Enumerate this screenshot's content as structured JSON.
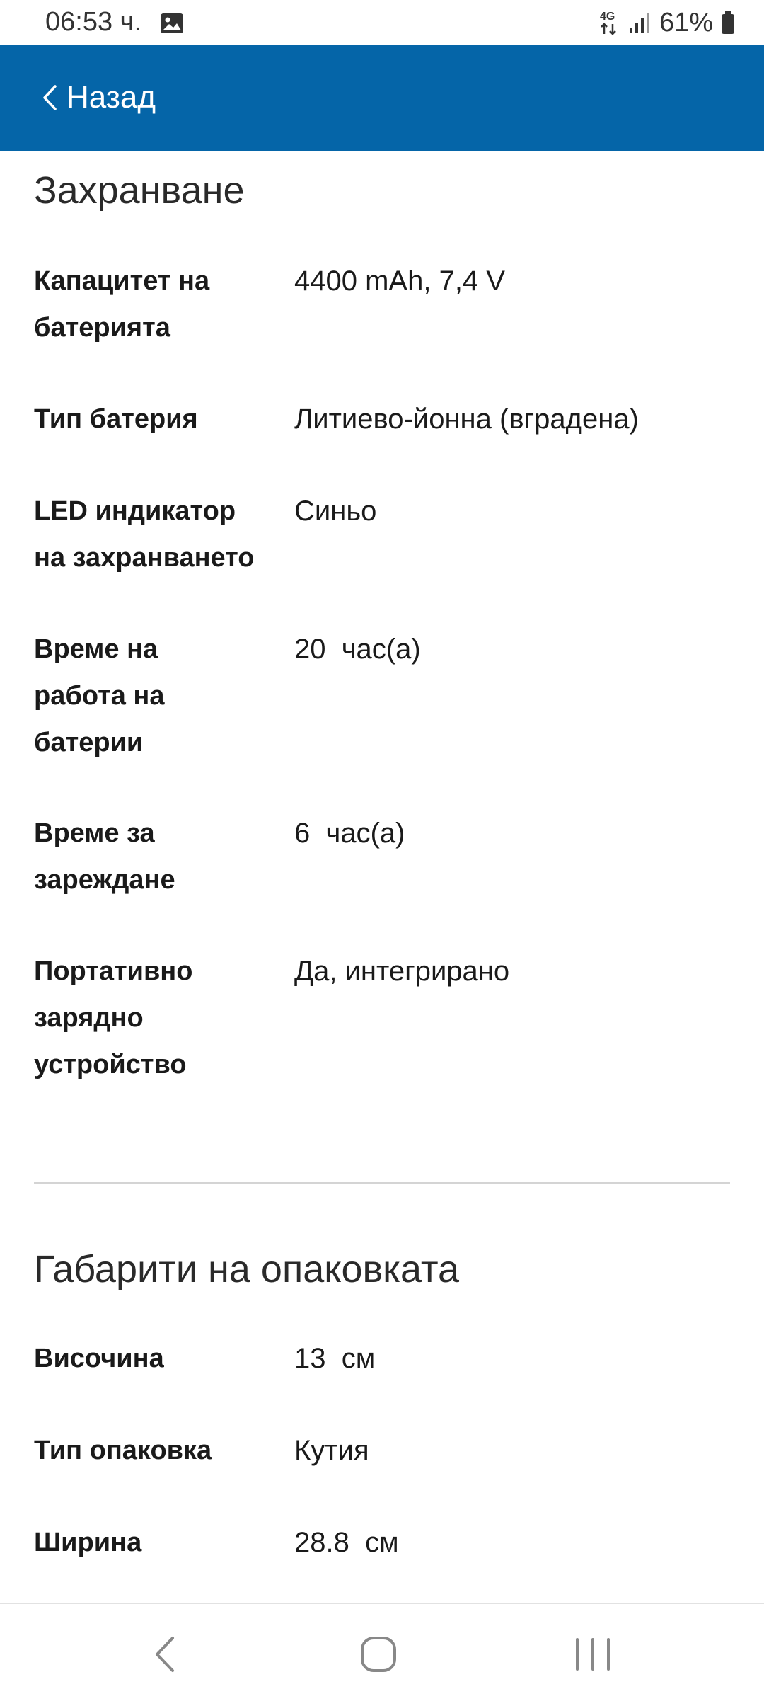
{
  "status_bar": {
    "time": "06:53 ч.",
    "battery": "61%",
    "network": "4G",
    "icons": [
      "image-icon",
      "network-4g-icon",
      "signal-icon",
      "battery-icon"
    ]
  },
  "header": {
    "back_label": "Назад",
    "background_color": "#0565a8"
  },
  "sections": [
    {
      "title": "Захранване",
      "rows": [
        {
          "label": "Капацитет на\nбатерията",
          "value": "4400 mAh, 7,4 V"
        },
        {
          "label": "Тип батерия",
          "value": "Литиево-йонна (вградена)"
        },
        {
          "label": "LED индикатор\nна захранването",
          "value": "Синьо"
        },
        {
          "label": "Време на\nработа на\nбатерии",
          "value": "20  час(а)"
        },
        {
          "label": "Време за\nзареждане",
          "value": "6  час(а)"
        },
        {
          "label": "Портативно\nзарядно\nустройство",
          "value": "Да, интегрирано"
        }
      ]
    },
    {
      "title": "Габарити на опаковката",
      "rows": [
        {
          "label": "Височина",
          "value": "13  см"
        },
        {
          "label": "Тип опаковка",
          "value": "Кутия"
        },
        {
          "label": "Ширина",
          "value": "28.8  см"
        }
      ]
    }
  ],
  "nav_bar": {
    "icons": [
      "back-nav-icon",
      "home-nav-icon",
      "recents-nav-icon"
    ]
  }
}
